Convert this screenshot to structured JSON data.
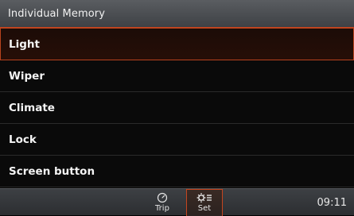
{
  "header": {
    "title": "Individual Memory"
  },
  "menu": {
    "items": [
      {
        "label": "Light"
      },
      {
        "label": "Wiper"
      },
      {
        "label": "Climate"
      },
      {
        "label": "Lock"
      },
      {
        "label": "Screen button"
      }
    ],
    "selected": "Light"
  },
  "bottom_bar": {
    "tabs": [
      {
        "label": "Trip",
        "icon": "speedometer-icon"
      },
      {
        "label": "Set",
        "icon": "settings-list-icon",
        "active": true
      }
    ],
    "clock": "09:11"
  },
  "colors": {
    "accent": "#c4451f",
    "background": "#000000",
    "header_bg": "#4a4d51"
  }
}
